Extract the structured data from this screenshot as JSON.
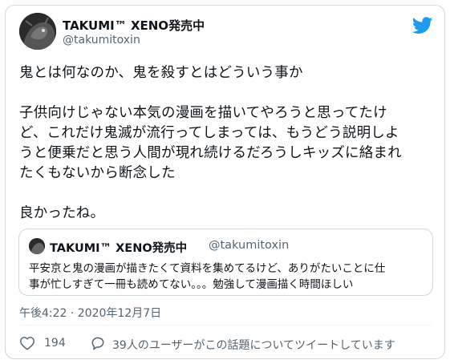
{
  "author": {
    "name": "TAKUMI™ XENO発売中",
    "handle": "@takumitoxin"
  },
  "tweet": {
    "lines": [
      "鬼とは何なのか、鬼を殺すとはどういう事か",
      "",
      "子供向けじゃない本気の漫画を描いてやろうと思ってたけ",
      "ど、これだけ鬼滅が流行ってしまっては、もうどう説明しよ",
      "うと便乗だと思う人間が現れ続けるだろうしキッズに絡まれ",
      "たくもないから断念した",
      "",
      "良かったね。"
    ]
  },
  "quote": {
    "name": "TAKUMI™ XENO発売中",
    "handle": "@takumitoxin",
    "lines": [
      "平安京と鬼の漫画が描きたくて資料を集めてるけど、ありがたいことに仕",
      "事が忙しすぎて一冊も読めてない。。。勉強して漫画描く時間ほしい"
    ]
  },
  "timestamp": "午後4:22 · 2020年12月7日",
  "actions": {
    "like_count": "194",
    "replies_text": "39人のユーザーがこの話題についてツイートしています"
  },
  "icons": {
    "brand": "twitter-bird-icon",
    "like": "heart-icon",
    "reply": "speech-bubble-icon"
  },
  "colors": {
    "brand": "#1d9bf0",
    "secondary_text": "#536471",
    "border": "#cfd9de"
  }
}
